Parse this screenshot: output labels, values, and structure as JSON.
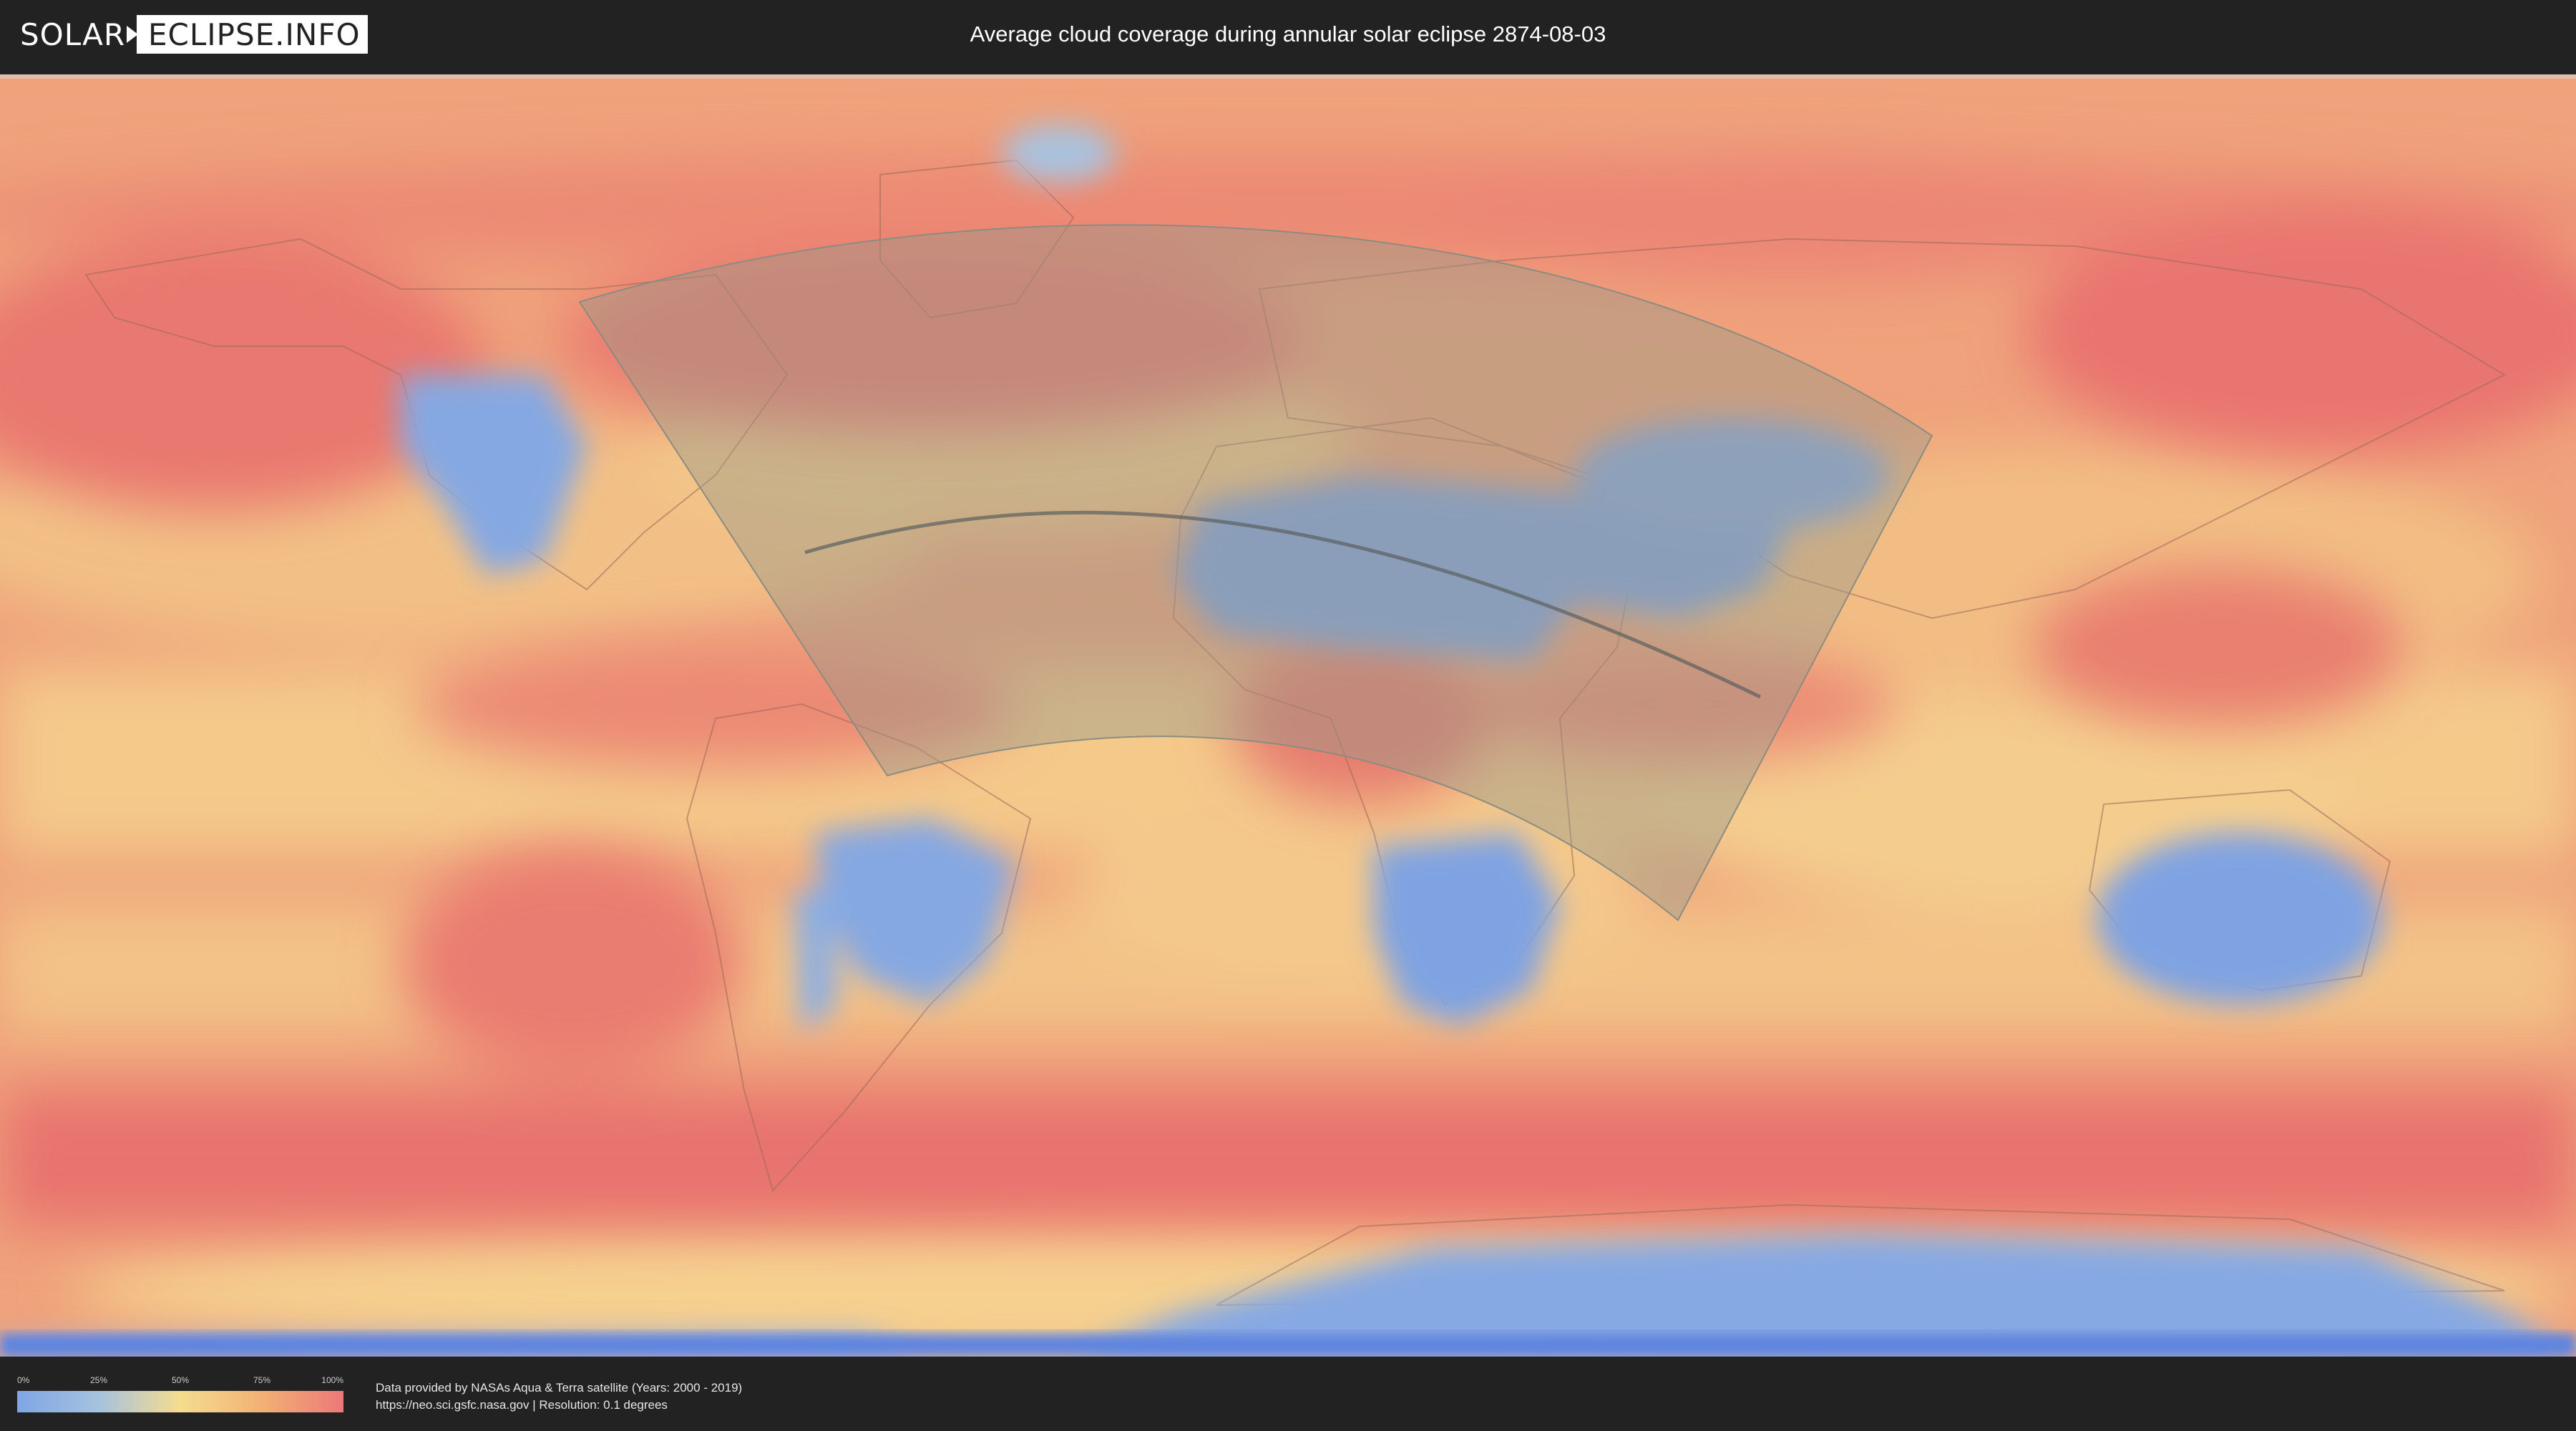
{
  "header": {
    "logo_left": "SOLAR",
    "logo_right": "ECLIPSE.INFO",
    "title": "Average cloud coverage during annular solar eclipse 2874-08-03"
  },
  "legend": {
    "ticks": [
      "0%",
      "25%",
      "50%",
      "75%",
      "100%"
    ],
    "colors": [
      "#7fa5e6",
      "#a6c2de",
      "#f5dc8f",
      "#f2b174",
      "#ec7878"
    ]
  },
  "credits": {
    "line1": "Data provided by NASAs Aqua & Terra satellite (Years: 2000 - 2019)",
    "line2": "https://neo.sci.gsfc.nasa.gov | Resolution: 0.1 degrees"
  },
  "map": {
    "projection": "equirectangular",
    "cloud_high_color": "#e97a6e",
    "cloud_mid_color": "#f3c786",
    "cloud_low_color": "#7ea3e3",
    "eclipse_band_color": "#9a9a8a",
    "central_line_color": "#5b6060"
  }
}
